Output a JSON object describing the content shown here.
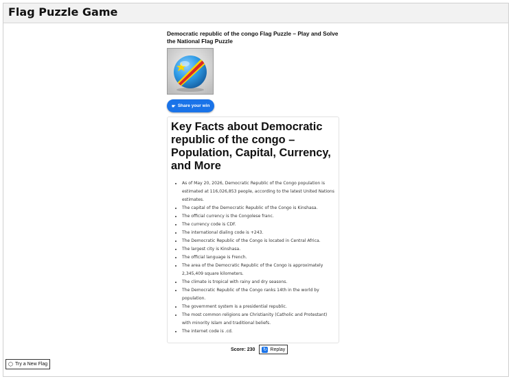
{
  "app": {
    "title": "Flag Puzzle Game"
  },
  "puzzle": {
    "title": "Democratic republic of the congo Flag Puzzle – Play and Solve the National Flag Puzzle"
  },
  "share": {
    "label": "Share your win",
    "icon": "hand-icon"
  },
  "facts": {
    "heading": "Key Facts about Democratic republic of the congo – Population, Capital, Currency, and More",
    "items": [
      "As of May 20, 2026, Democratic Republic of the Congo population is estimated at 116,026,853 people, according to the latest United Nations estimates.",
      "The capital of the Democratic Republic of the Congo is Kinshasa.",
      "The official currency is the Congolese franc.",
      "The currency code is CDF.",
      "The international dialing code is +243.",
      "The Democratic Republic of the Congo is located in Central Africa.",
      "The largest city is Kinshasa.",
      "The official language is French.",
      "The area of the Democratic Republic of the Congo is approximately 2,345,409 square kilometers.",
      "The climate is tropical with rainy and dry seasons.",
      "The Democratic Republic of the Congo ranks 14th in the world by population.",
      "The government system is a presidential republic.",
      "The most common religions are Christianity (Catholic and Protestant) with minority Islam and traditional beliefs.",
      "The internet code is .cd."
    ]
  },
  "score": {
    "label": "Score: 230"
  },
  "replay": {
    "label": "Replay"
  },
  "new_flag": {
    "label": "Try a New Flag"
  },
  "colors": {
    "accent": "#1a73e8",
    "flag_blue": "#2e9be6",
    "flag_red": "#d8262a",
    "flag_yellow": "#f6d500"
  }
}
